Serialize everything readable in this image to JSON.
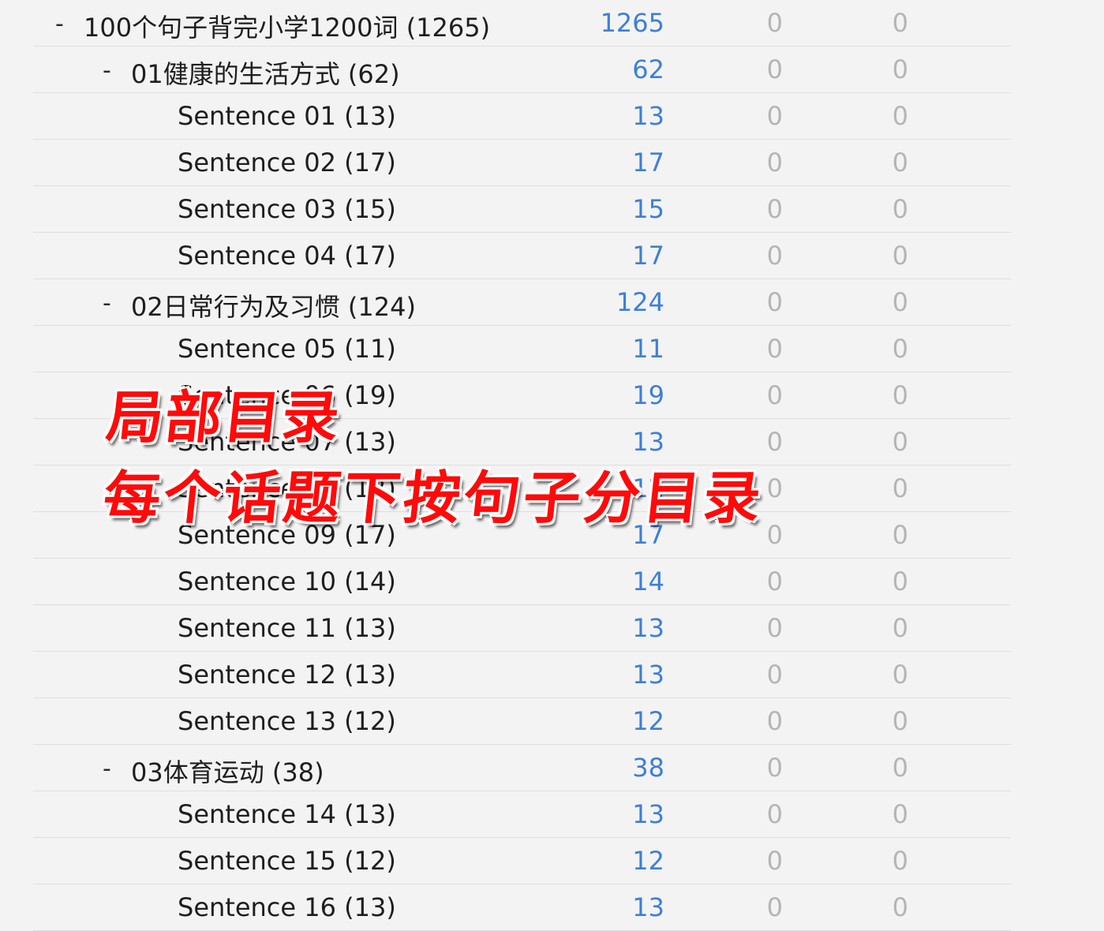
{
  "deck_tree": {
    "rows": [
      {
        "level": 0,
        "toggle": "-",
        "name": "100个句子背完小学1200词 (1265)",
        "new": "1265",
        "learn": "0",
        "review": "0"
      },
      {
        "level": 1,
        "toggle": "-",
        "name": "01健康的生活方式 (62)",
        "new": "62",
        "learn": "0",
        "review": "0"
      },
      {
        "level": 2,
        "toggle": "",
        "name": "Sentence 01 (13)",
        "new": "13",
        "learn": "0",
        "review": "0"
      },
      {
        "level": 2,
        "toggle": "",
        "name": "Sentence 02 (17)",
        "new": "17",
        "learn": "0",
        "review": "0"
      },
      {
        "level": 2,
        "toggle": "",
        "name": "Sentence 03 (15)",
        "new": "15",
        "learn": "0",
        "review": "0"
      },
      {
        "level": 2,
        "toggle": "",
        "name": "Sentence 04 (17)",
        "new": "17",
        "learn": "0",
        "review": "0"
      },
      {
        "level": 1,
        "toggle": "-",
        "name": "02日常行为及习惯 (124)",
        "new": "124",
        "learn": "0",
        "review": "0"
      },
      {
        "level": 2,
        "toggle": "",
        "name": "Sentence 05 (11)",
        "new": "11",
        "learn": "0",
        "review": "0"
      },
      {
        "level": 2,
        "toggle": "",
        "name": "Sentence 06 (19)",
        "new": "19",
        "learn": "0",
        "review": "0"
      },
      {
        "level": 2,
        "toggle": "",
        "name": "Sentence 07 (13)",
        "new": "13",
        "learn": "0",
        "review": "0"
      },
      {
        "level": 2,
        "toggle": "",
        "name": "Sentence 08 (12)",
        "new": "12",
        "learn": "0",
        "review": "0"
      },
      {
        "level": 2,
        "toggle": "",
        "name": "Sentence 09 (17)",
        "new": "17",
        "learn": "0",
        "review": "0"
      },
      {
        "level": 2,
        "toggle": "",
        "name": "Sentence 10 (14)",
        "new": "14",
        "learn": "0",
        "review": "0"
      },
      {
        "level": 2,
        "toggle": "",
        "name": "Sentence 11 (13)",
        "new": "13",
        "learn": "0",
        "review": "0"
      },
      {
        "level": 2,
        "toggle": "",
        "name": "Sentence 12 (13)",
        "new": "13",
        "learn": "0",
        "review": "0"
      },
      {
        "level": 2,
        "toggle": "",
        "name": "Sentence 13 (12)",
        "new": "12",
        "learn": "0",
        "review": "0"
      },
      {
        "level": 1,
        "toggle": "-",
        "name": "03体育运动 (38)",
        "new": "38",
        "learn": "0",
        "review": "0"
      },
      {
        "level": 2,
        "toggle": "",
        "name": "Sentence 14 (13)",
        "new": "13",
        "learn": "0",
        "review": "0"
      },
      {
        "level": 2,
        "toggle": "",
        "name": "Sentence 15 (12)",
        "new": "12",
        "learn": "0",
        "review": "0"
      },
      {
        "level": 2,
        "toggle": "",
        "name": "Sentence 16 (13)",
        "new": "13",
        "learn": "0",
        "review": "0"
      }
    ]
  },
  "overlay": {
    "line1": "局部目录",
    "line2": "每个话题下按句子分目录"
  },
  "colors": {
    "background": "#f3f3f3",
    "new_count": "#3d7fd6",
    "zero_count": "#b5b5b5",
    "caption": "#ff0a0a"
  }
}
